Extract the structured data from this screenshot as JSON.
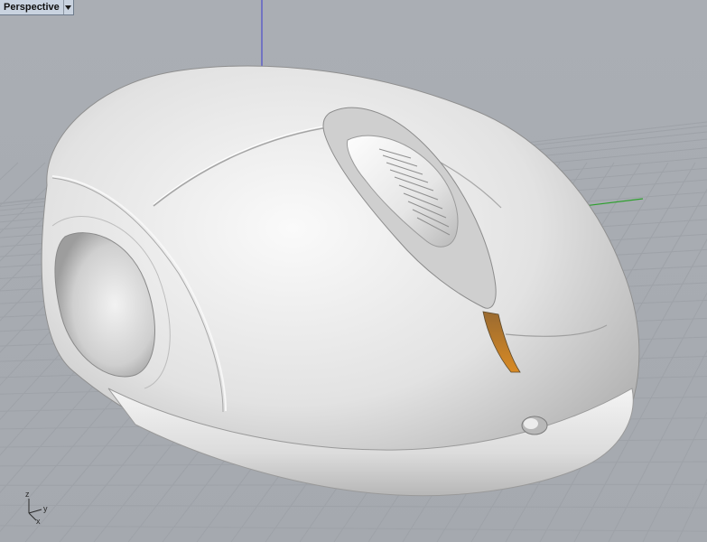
{
  "viewport": {
    "title": "Perspective",
    "menu_icon": "triangle-down-icon"
  },
  "axis_gizmo": {
    "z_label": "z",
    "y_label": "y",
    "x_label": "x"
  },
  "colors": {
    "background": "#aaaeb4",
    "grid_line": "#9ea2a8",
    "x_axis": "#c04040",
    "y_axis": "#2fa02f",
    "z_axis": "#3a3ad0",
    "model_surface": "#d9d9d9",
    "slot_interior": "#c8801e"
  }
}
